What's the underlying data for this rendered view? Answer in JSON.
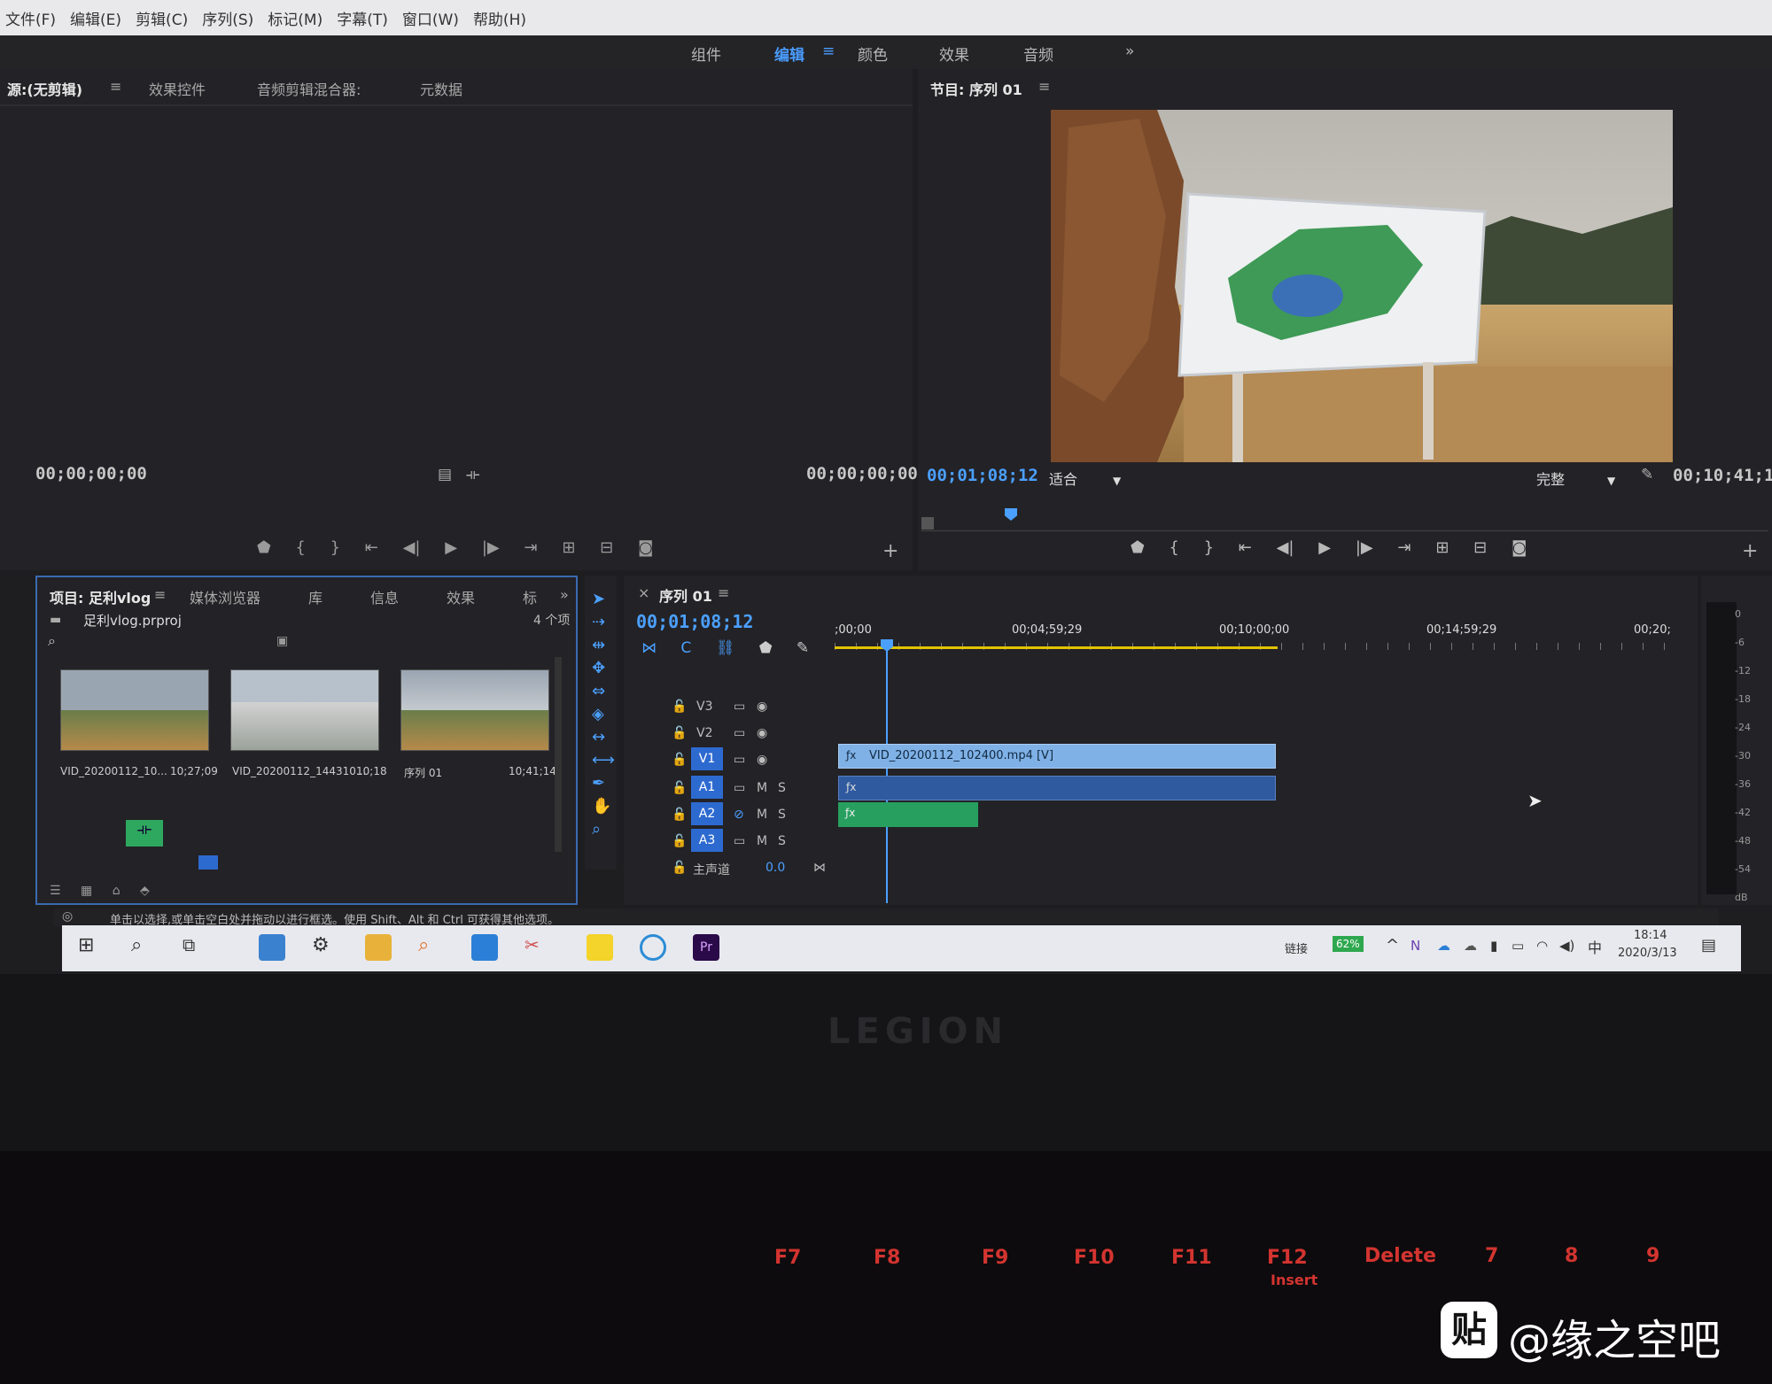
{
  "menu": [
    "文件(F)",
    "编辑(E)",
    "剪辑(C)",
    "序列(S)",
    "标记(M)",
    "字幕(T)",
    "窗口(W)",
    "帮助(H)"
  ],
  "workspaces": {
    "items": [
      "组件",
      "编辑",
      "颜色",
      "效果",
      "音频"
    ],
    "active": "编辑",
    "more": "»"
  },
  "source_panel": {
    "tabs": [
      "源:(无剪辑)",
      "效果控件",
      "音频剪辑混合器:",
      "元数据"
    ],
    "timecode_left": "00;00;00;00",
    "timecode_right": "00;00;00;00"
  },
  "program_panel": {
    "title": "节目: 序列 01",
    "timecode_current": "00;01;08;12",
    "fit": "适合",
    "quality": "完整",
    "timecode_duration": "00;10;41;14"
  },
  "project_panel": {
    "tabs": [
      "项目: 足利vlog",
      "媒体浏览器",
      "库",
      "信息",
      "效果",
      "标"
    ],
    "file": "足利vlog.prproj",
    "item_count": "4 个项",
    "items": [
      {
        "name": "VID_20200112_10...",
        "duration": "10;27;09"
      },
      {
        "name": "VID_20200112_144310...",
        "duration": "10;18"
      },
      {
        "name": "序列 01",
        "duration": "10;41;14"
      }
    ]
  },
  "timeline": {
    "tab": "序列 01",
    "timecode": "00;01;08;12",
    "ruler": [
      ";00;00",
      "00;04;59;29",
      "00;10;00;00",
      "00;14;59;29",
      "00;20;"
    ],
    "tracks": [
      {
        "name": "V3"
      },
      {
        "name": "V2"
      },
      {
        "name": "V1"
      },
      {
        "name": "A1"
      },
      {
        "name": "A2"
      },
      {
        "name": "A3"
      }
    ],
    "master": {
      "name": "主声道",
      "value": "0.0"
    },
    "clip_v1": "VID_20200112_102400.mp4 [V]",
    "track_mute": "M",
    "track_solo": "S"
  },
  "meter_scale": [
    "0",
    "-6",
    "-12",
    "-18",
    "-24",
    "-30",
    "-36",
    "-42",
    "-48",
    "-54",
    "dB"
  ],
  "status_bar": "单击以选择,或单击空白处并拖动以进行框选。使用 Shift、Alt 和 Ctrl 可获得其他选项。",
  "taskbar": {
    "link": "链接",
    "battery": "62%",
    "ime": "中",
    "time": "18:14",
    "date": "2020/3/13"
  },
  "laptop_brand": "LEGION",
  "keys": [
    "F7",
    "F8",
    "F9",
    "F10",
    "F11",
    "F12",
    "Delete",
    "7",
    "8",
    "9"
  ],
  "key_sub": "Insert",
  "watermark": {
    "badge": "贴",
    "text": "@缘之空吧"
  },
  "colors": {
    "accent": "#4ba0ff",
    "panel": "#232226",
    "clip_video": "#7fb1e6",
    "clip_audio": "#2f5aa0",
    "clip_audio2": "#27a05f",
    "keyboard_led": "#d33430"
  }
}
